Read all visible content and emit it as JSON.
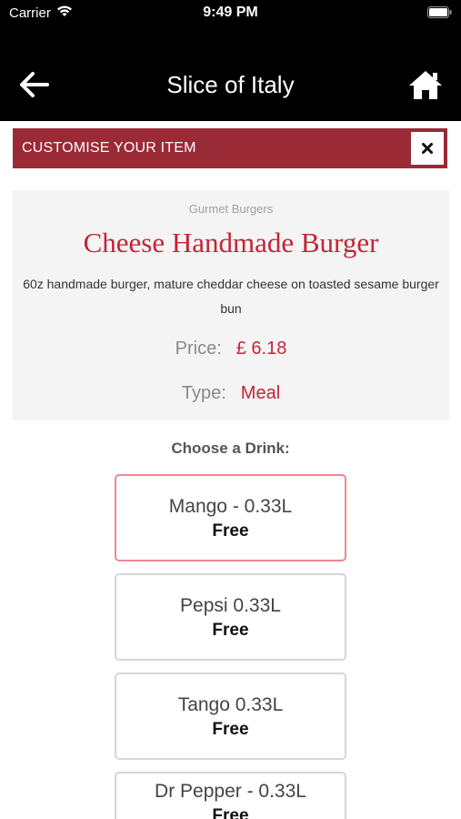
{
  "status_bar": {
    "carrier": "Carrier",
    "time": "9:49 PM"
  },
  "nav": {
    "title": "Slice of Italy",
    "back_icon": "arrow-left-icon",
    "home_icon": "home-icon"
  },
  "customise": {
    "title": "CUSTOMISE YOUR ITEM",
    "close_icon": "close-icon"
  },
  "item": {
    "category": "Gurmet Burgers",
    "name": "Cheese Handmade Burger",
    "description": "60z handmade burger, mature cheddar cheese on toasted sesame burger bun",
    "price_label": "Price:",
    "price": "£ 6.18",
    "type_label": "Type:",
    "type": "Meal"
  },
  "drinks": {
    "label": "Choose a Drink:",
    "options": [
      {
        "name": "Mango - 0.33L",
        "price": "Free",
        "selected": true
      },
      {
        "name": "Pepsi 0.33L",
        "price": "Free",
        "selected": false
      },
      {
        "name": "Tango 0.33L",
        "price": "Free",
        "selected": false
      },
      {
        "name": "Dr Pepper - 0.33L",
        "price": "Free",
        "selected": false
      }
    ]
  },
  "colors": {
    "accent": "#992a36",
    "price": "#c42436",
    "selected_border": "#f0888f"
  }
}
